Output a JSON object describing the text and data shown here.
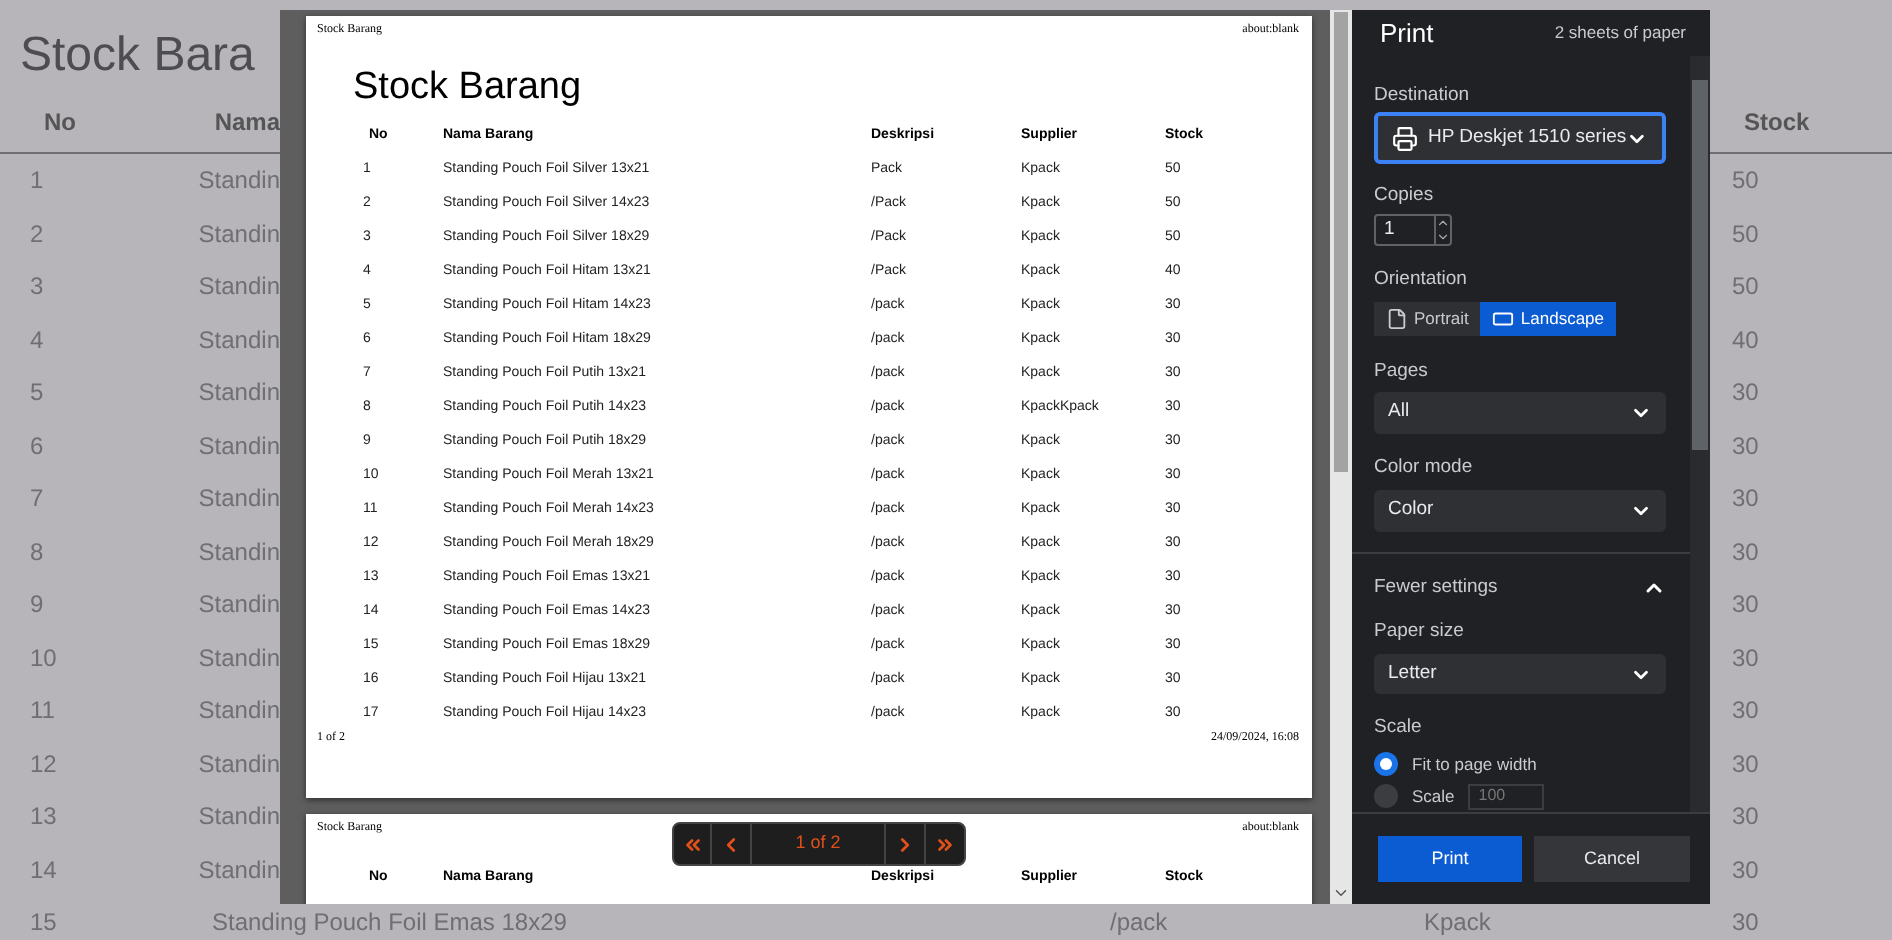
{
  "background_page": {
    "title": "Stock Bara",
    "columns": [
      "No",
      "Nama",
      "Stock"
    ],
    "rows": [
      {
        "no": "1",
        "name": "Standin",
        "stock": "50"
      },
      {
        "no": "2",
        "name": "Standin",
        "stock": "50"
      },
      {
        "no": "3",
        "name": "Standin",
        "stock": "50"
      },
      {
        "no": "4",
        "name": "Standin",
        "stock": "40"
      },
      {
        "no": "5",
        "name": "Standin",
        "stock": "30"
      },
      {
        "no": "6",
        "name": "Standin",
        "stock": "30"
      },
      {
        "no": "7",
        "name": "Standin",
        "stock": "30"
      },
      {
        "no": "8",
        "name": "Standin",
        "stock": "30"
      },
      {
        "no": "9",
        "name": "Standin",
        "stock": "30"
      },
      {
        "no": "10",
        "name": "Standin",
        "stock": "30"
      },
      {
        "no": "11",
        "name": "Standin",
        "stock": "30"
      },
      {
        "no": "12",
        "name": "Standin",
        "stock": "30"
      },
      {
        "no": "13",
        "name": "Standin",
        "stock": "30"
      },
      {
        "no": "14",
        "name": "Standin",
        "stock": "30"
      }
    ],
    "last_row": {
      "no": "15",
      "name": "Standing Pouch Foil Emas 18x29",
      "deskripsi": "/pack",
      "supplier": "Kpack",
      "stock": "30"
    }
  },
  "preview": {
    "pages": [
      {
        "header_left": "Stock Barang",
        "header_right": "about:blank",
        "title": "Stock Barang",
        "columns": [
          "No",
          "Nama Barang",
          "Deskripsi",
          "Supplier",
          "Stock"
        ],
        "rows": [
          [
            "1",
            "Standing Pouch Foil Silver 13x21",
            "Pack",
            "Kpack",
            "50"
          ],
          [
            "2",
            "Standing Pouch Foil Silver 14x23",
            "/Pack",
            "Kpack",
            "50"
          ],
          [
            "3",
            "Standing Pouch Foil Silver 18x29",
            "/Pack",
            "Kpack",
            "50"
          ],
          [
            "4",
            "Standing Pouch Foil Hitam 13x21",
            "/Pack",
            "Kpack",
            "40"
          ],
          [
            "5",
            "Standing Pouch Foil Hitam 14x23",
            "/pack",
            "Kpack",
            "30"
          ],
          [
            "6",
            "Standing Pouch Foil Hitam 18x29",
            "/pack",
            "Kpack",
            "30"
          ],
          [
            "7",
            "Standing Pouch Foil Putih 13x21",
            "/pack",
            "Kpack",
            "30"
          ],
          [
            "8",
            "Standing Pouch Foil Putih 14x23",
            "/pack",
            "KpackKpack",
            "30"
          ],
          [
            "9",
            "Standing Pouch Foil Putih 18x29",
            "/pack",
            "Kpack",
            "30"
          ],
          [
            "10",
            "Standing Pouch Foil Merah 13x21",
            "/pack",
            "Kpack",
            "30"
          ],
          [
            "11",
            "Standing Pouch Foil Merah 14x23",
            "/pack",
            "Kpack",
            "30"
          ],
          [
            "12",
            "Standing Pouch Foil Merah 18x29",
            "/pack",
            "Kpack",
            "30"
          ],
          [
            "13",
            "Standing Pouch Foil Emas 13x21",
            "/pack",
            "Kpack",
            "30"
          ],
          [
            "14",
            "Standing Pouch Foil Emas 14x23",
            "/pack",
            "Kpack",
            "30"
          ],
          [
            "15",
            "Standing Pouch Foil Emas 18x29",
            "/pack",
            "Kpack",
            "30"
          ],
          [
            "16",
            "Standing Pouch Foil Hijau 13x21",
            "/pack",
            "Kpack",
            "30"
          ],
          [
            "17",
            "Standing Pouch Foil Hijau 14x23",
            "/pack",
            "Kpack",
            "30"
          ]
        ],
        "footer_left": "1 of 2",
        "footer_right": "24/09/2024, 16:08"
      },
      {
        "header_left": "Stock Barang",
        "header_right": "about:blank",
        "columns": [
          "No",
          "Nama Barang",
          "Deskripsi",
          "Supplier",
          "Stock"
        ]
      }
    ],
    "pager": {
      "label": "1 of 2"
    }
  },
  "print_panel": {
    "title": "Print",
    "sheets": "2 sheets of paper",
    "destination": {
      "label": "Destination",
      "value": "HP Deskjet 1510 series"
    },
    "copies": {
      "label": "Copies",
      "value": "1"
    },
    "orientation": {
      "label": "Orientation",
      "options": [
        {
          "label": "Portrait",
          "kind": "portrait",
          "selected": false
        },
        {
          "label": "Landscape",
          "kind": "landscape",
          "selected": true
        }
      ]
    },
    "pages": {
      "label": "Pages",
      "value": "All"
    },
    "color_mode": {
      "label": "Color mode",
      "value": "Color"
    },
    "more_settings": {
      "label": "Fewer settings",
      "expanded": true
    },
    "paper_size": {
      "label": "Paper size",
      "value": "Letter"
    },
    "scale": {
      "label": "Scale",
      "options": [
        {
          "label": "Fit to page width",
          "selected": true
        },
        {
          "label": "Scale",
          "value": "100",
          "disabled": true,
          "selected": false
        }
      ]
    },
    "buttons": [
      {
        "label": "Print",
        "kind": "primary"
      },
      {
        "label": "Cancel",
        "kind": "secondary"
      }
    ]
  }
}
